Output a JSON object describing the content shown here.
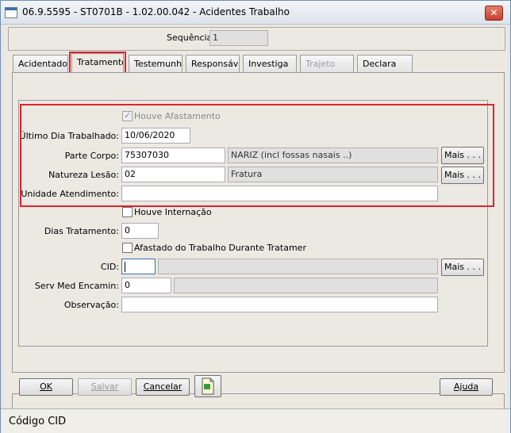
{
  "window": {
    "title": "06.9.5595 - ST0701B - 1.02.00.042 - Acidentes Trabalho",
    "close_glyph": "✕"
  },
  "header": {
    "sequencia_label": "Sequência:",
    "sequencia_value": "1"
  },
  "tabs": [
    {
      "label": "Acidentado"
    },
    {
      "label": "Tratamento"
    },
    {
      "label": "Testemunha"
    },
    {
      "label": "Responsáv"
    },
    {
      "label": "Investiga"
    },
    {
      "label": "Trajeto"
    },
    {
      "label": "Declara"
    }
  ],
  "form": {
    "houve_afastamento": {
      "label": "Houve Afastamento",
      "checked": true,
      "mark": "✓"
    },
    "ultimo_dia": {
      "label": "Último Dia Trabalhado:",
      "value": "10/06/2020"
    },
    "parte_corpo": {
      "label": "Parte Corpo:",
      "code": "75307030",
      "desc": "NARIZ (incl fossas nasais ..)",
      "more": "Mais . . ."
    },
    "natureza_lesao": {
      "label": "Natureza Lesão:",
      "code": "02",
      "desc": "Fratura",
      "more": "Mais . . ."
    },
    "unidade_atendimento": {
      "label": "Unidade Atendimento:",
      "value": ""
    },
    "houve_internacao": {
      "label": "Houve Internação",
      "checked": false
    },
    "dias_tratamento": {
      "label": "Dias Tratamento:",
      "value": "0"
    },
    "afastado": {
      "label": "Afastado do Trabalho Durante Tratamer",
      "checked": false
    },
    "cid": {
      "label": "CID:",
      "value": "",
      "desc": "",
      "more": "Mais . . ."
    },
    "serv_med": {
      "label": "Serv Med Encamin:",
      "value": "0",
      "desc": ""
    },
    "observacao": {
      "label": "Observação:",
      "value": ""
    }
  },
  "buttons": {
    "ok": "OK",
    "salvar": "Salvar",
    "cancelar": "Cancelar",
    "ajuda": "Ajuda"
  },
  "status": {
    "text": "Código CID"
  },
  "colors": {
    "highlight": "#e0222e",
    "window_border": "#6f8fb8"
  }
}
